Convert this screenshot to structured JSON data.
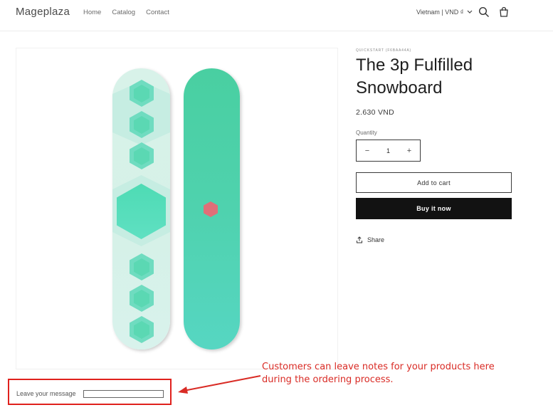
{
  "header": {
    "logo": "Mageplaza",
    "nav": [
      "Home",
      "Catalog",
      "Contact"
    ],
    "locale": "Vietnam | VND ₫",
    "icons": {
      "search": "search-icon",
      "cart": "cart-icon",
      "dropdown": "chevron-down-icon"
    }
  },
  "product": {
    "vendor": "QUICKSTART (F6BAA44A)",
    "title": "The 3p Fulfilled Snowboard",
    "price": "2.630 VND",
    "quantity_label": "Quantity",
    "quantity_value": "1",
    "decrease": "−",
    "increase": "+",
    "add_to_cart": "Add to cart",
    "buy_now": "Buy it now",
    "share": "Share"
  },
  "message": {
    "label": "Leave your message",
    "value": ""
  },
  "annotation": {
    "text": "Customers can leave notes for your products here during the ordering process."
  },
  "colors": {
    "accent_red": "#e0211d",
    "board_mint": "#4fd2ae",
    "button_dark": "#121212"
  }
}
